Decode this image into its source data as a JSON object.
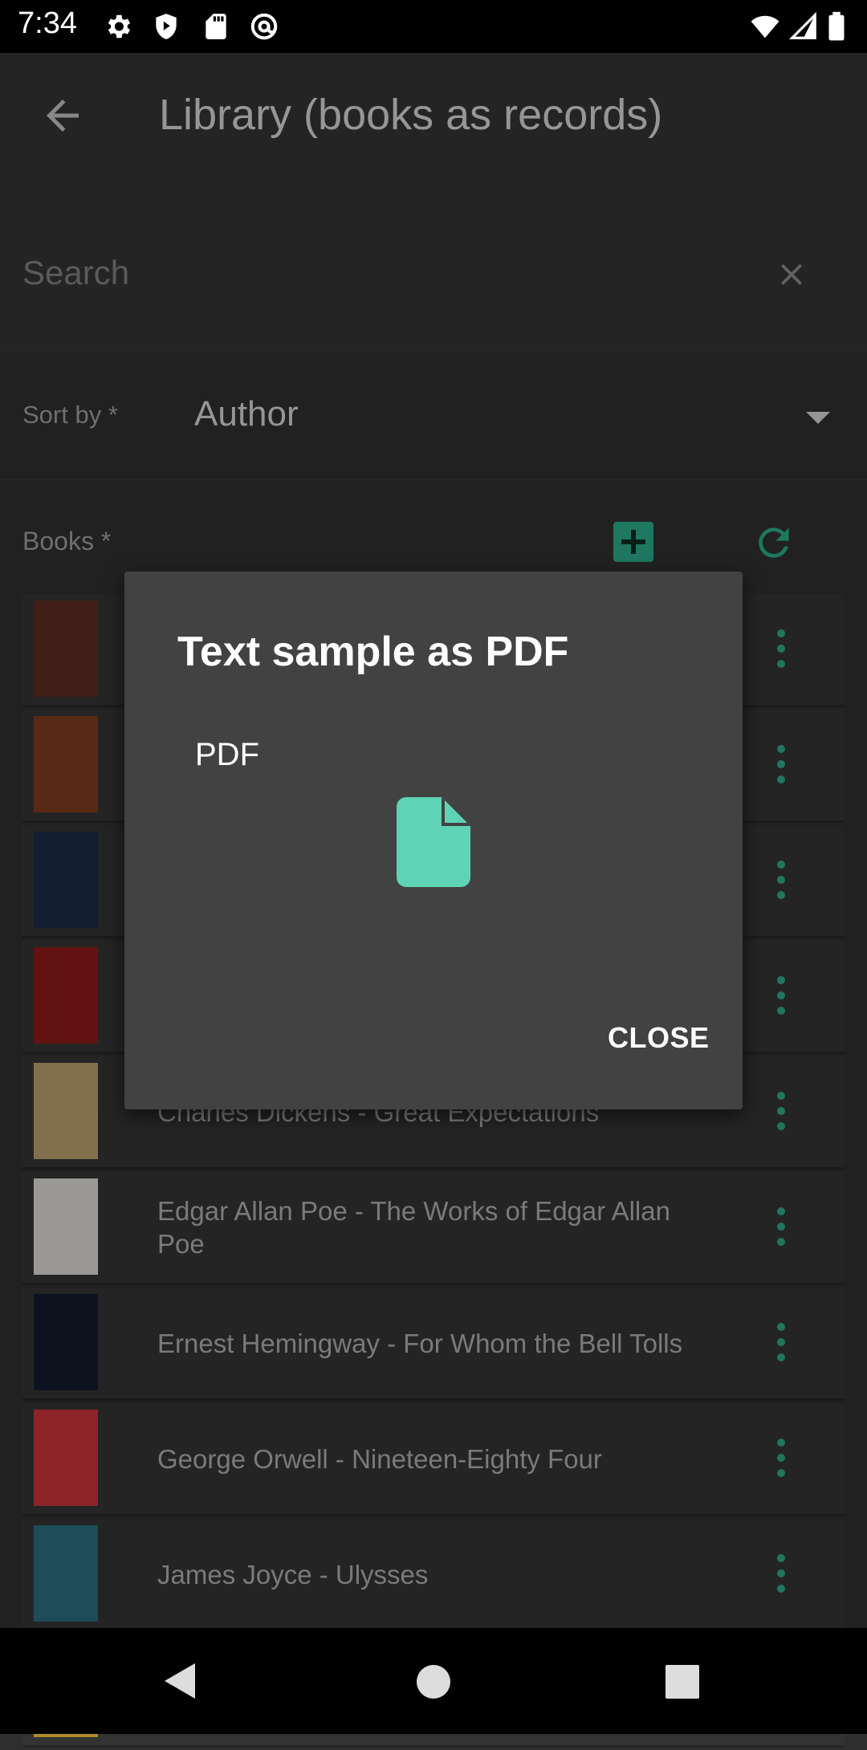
{
  "status_bar": {
    "time": "7:34",
    "left_icons": [
      "settings-icon",
      "shield-play-icon",
      "sd-card-icon",
      "at-sign-icon"
    ],
    "right_icons": [
      "wifi-icon",
      "signal-icon",
      "battery-icon"
    ]
  },
  "app_bar": {
    "title": "Library (books as records)",
    "back_icon": "arrow-back-icon"
  },
  "search": {
    "placeholder": "Search",
    "clear_icon": "close-icon"
  },
  "sort": {
    "label": "Sort by *",
    "value": "Author"
  },
  "books": {
    "label": "Books *",
    "add_icon": "add-box-icon",
    "refresh_icon": "refresh-icon",
    "items": [
      {
        "title": "",
        "cover_color": "#5a2a20"
      },
      {
        "title": "",
        "cover_color": "#7a3a1e"
      },
      {
        "title": "",
        "cover_color": "#1c2a44"
      },
      {
        "title": "",
        "cover_color": "#8a1a1a"
      },
      {
        "title": "Charles Dickens - Great Expectations",
        "cover_color": "#b49a6a"
      },
      {
        "title": "Edgar Allan Poe - The Works of Edgar Allan Poe",
        "cover_color": "#d7d5cf"
      },
      {
        "title": "Ernest Hemingway - For Whom the Bell Tolls",
        "cover_color": "#111a2a"
      },
      {
        "title": "George Orwell - Nineteen-Eighty Four",
        "cover_color": "#c2323a"
      },
      {
        "title": "James Joyce - Ulysses",
        "cover_color": "#2a6a7a"
      },
      {
        "title": "",
        "cover_color": "#b08a2a"
      }
    ]
  },
  "dialog": {
    "title": "Text sample as PDF",
    "subtitle": "PDF",
    "file_icon": "file-icon",
    "close_label": "CLOSE"
  },
  "colors": {
    "accent": "#2aa584",
    "file_icon": "#5fd3b5",
    "dialog_bg": "#424242"
  }
}
